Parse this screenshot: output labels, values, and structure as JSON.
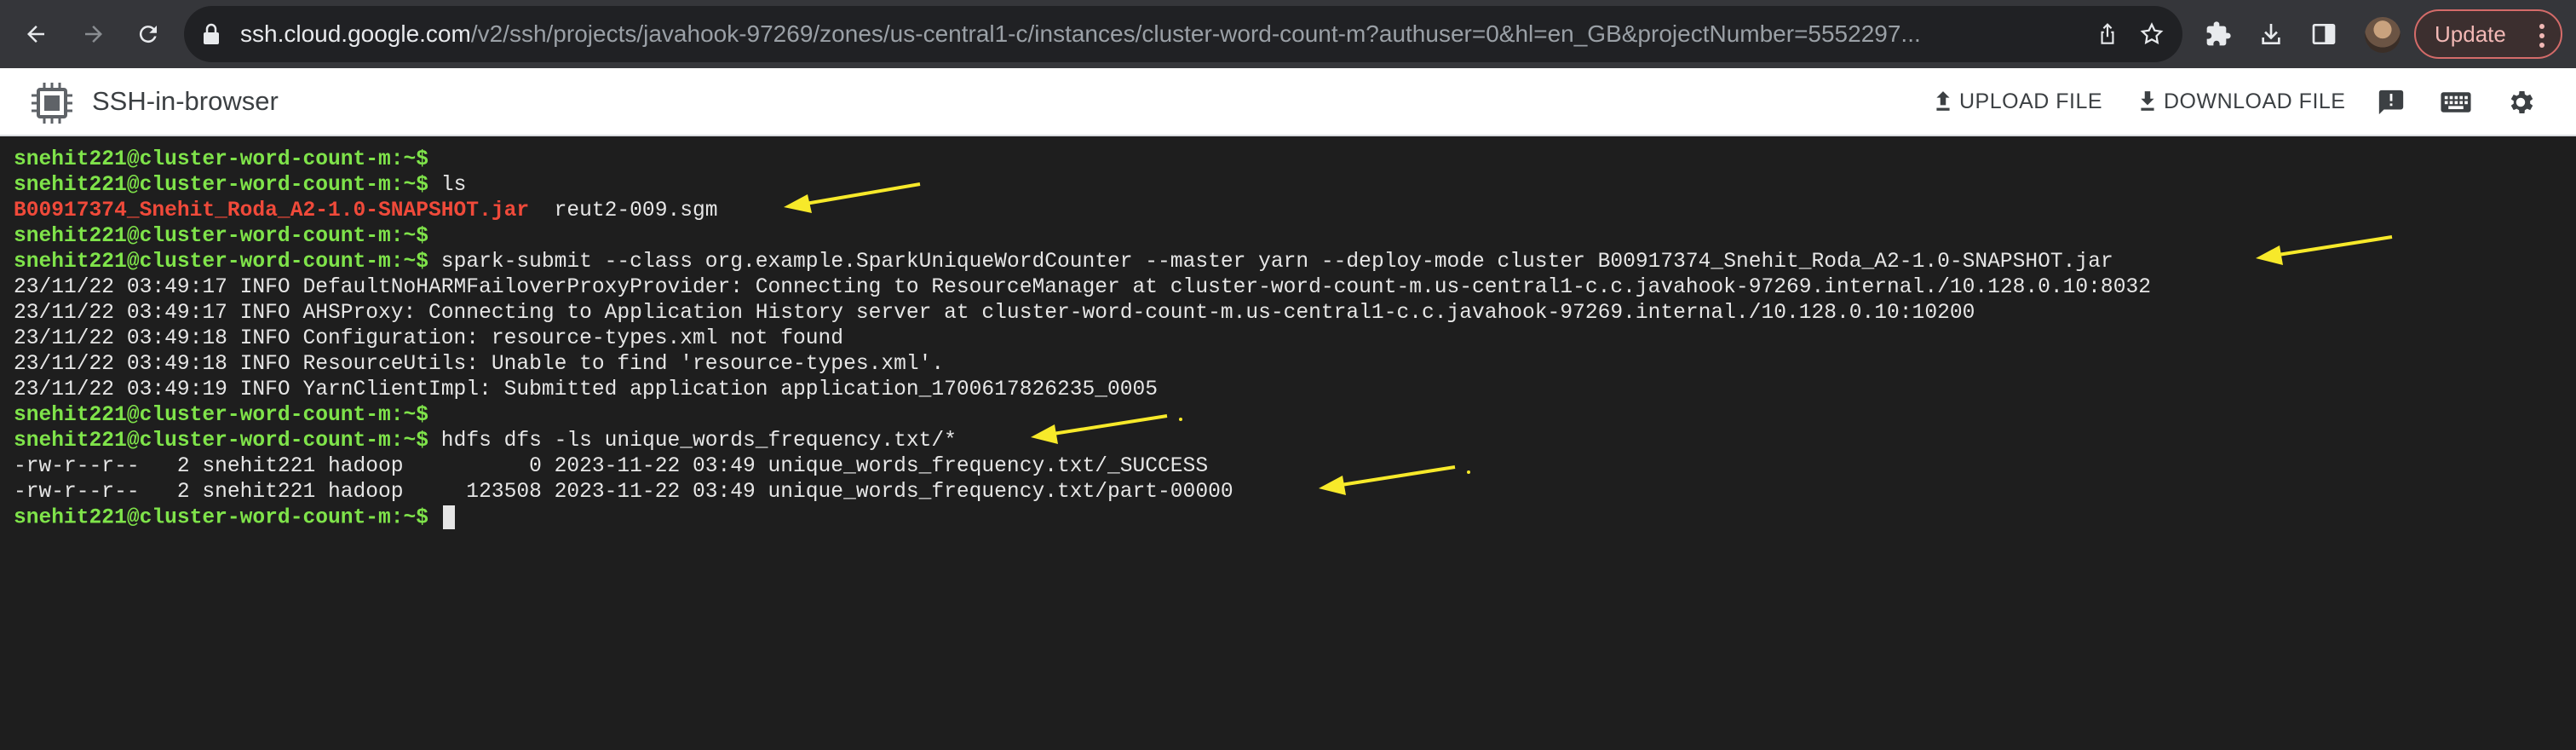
{
  "browser": {
    "url_host": "ssh.cloud.google.com",
    "url_path": "/v2/ssh/projects/javahook-97269/zones/us-central1-c/instances/cluster-word-count-m?authuser=0&hl=en_GB&projectNumber=5552297...",
    "update_label": "Update"
  },
  "app": {
    "title": "SSH-in-browser",
    "upload_label": "UPLOAD FILE",
    "download_label": "DOWNLOAD FILE"
  },
  "terminal": {
    "prompt": "snehit221@cluster-word-count-m:~$",
    "lines": [
      {
        "cmd": ""
      },
      {
        "cmd": " ls"
      },
      {
        "jar": "B00917374_Snehit_Roda_A2-1.0-SNAPSHOT.jar",
        "text": "  reut2-009.sgm"
      },
      {
        "cmd": ""
      },
      {
        "cmd": " spark-submit --class org.example.SparkUniqueWordCounter --master yarn --deploy-mode cluster B00917374_Snehit_Roda_A2-1.0-SNAPSHOT.jar"
      },
      {
        "text": "23/11/22 03:49:17 INFO DefaultNoHARMFailoverProxyProvider: Connecting to ResourceManager at cluster-word-count-m.us-central1-c.c.javahook-97269.internal./10.128.0.10:8032"
      },
      {
        "text": "23/11/22 03:49:17 INFO AHSProxy: Connecting to Application History server at cluster-word-count-m.us-central1-c.c.javahook-97269.internal./10.128.0.10:10200"
      },
      {
        "text": "23/11/22 03:49:18 INFO Configuration: resource-types.xml not found"
      },
      {
        "text": "23/11/22 03:49:18 INFO ResourceUtils: Unable to find 'resource-types.xml'."
      },
      {
        "text": "23/11/22 03:49:19 INFO YarnClientImpl: Submitted application application_1700617826235_0005"
      },
      {
        "cmd": ""
      },
      {
        "cmd": " hdfs dfs -ls unique_words_frequency.txt/*"
      },
      {
        "text": "-rw-r--r--   2 snehit221 hadoop          0 2023-11-22 03:49 unique_words_frequency.txt/_SUCCESS"
      },
      {
        "text": "-rw-r--r--   2 snehit221 hadoop     123508 2023-11-22 03:49 unique_words_frequency.txt/part-00000"
      },
      {
        "cmd": " "
      }
    ]
  }
}
